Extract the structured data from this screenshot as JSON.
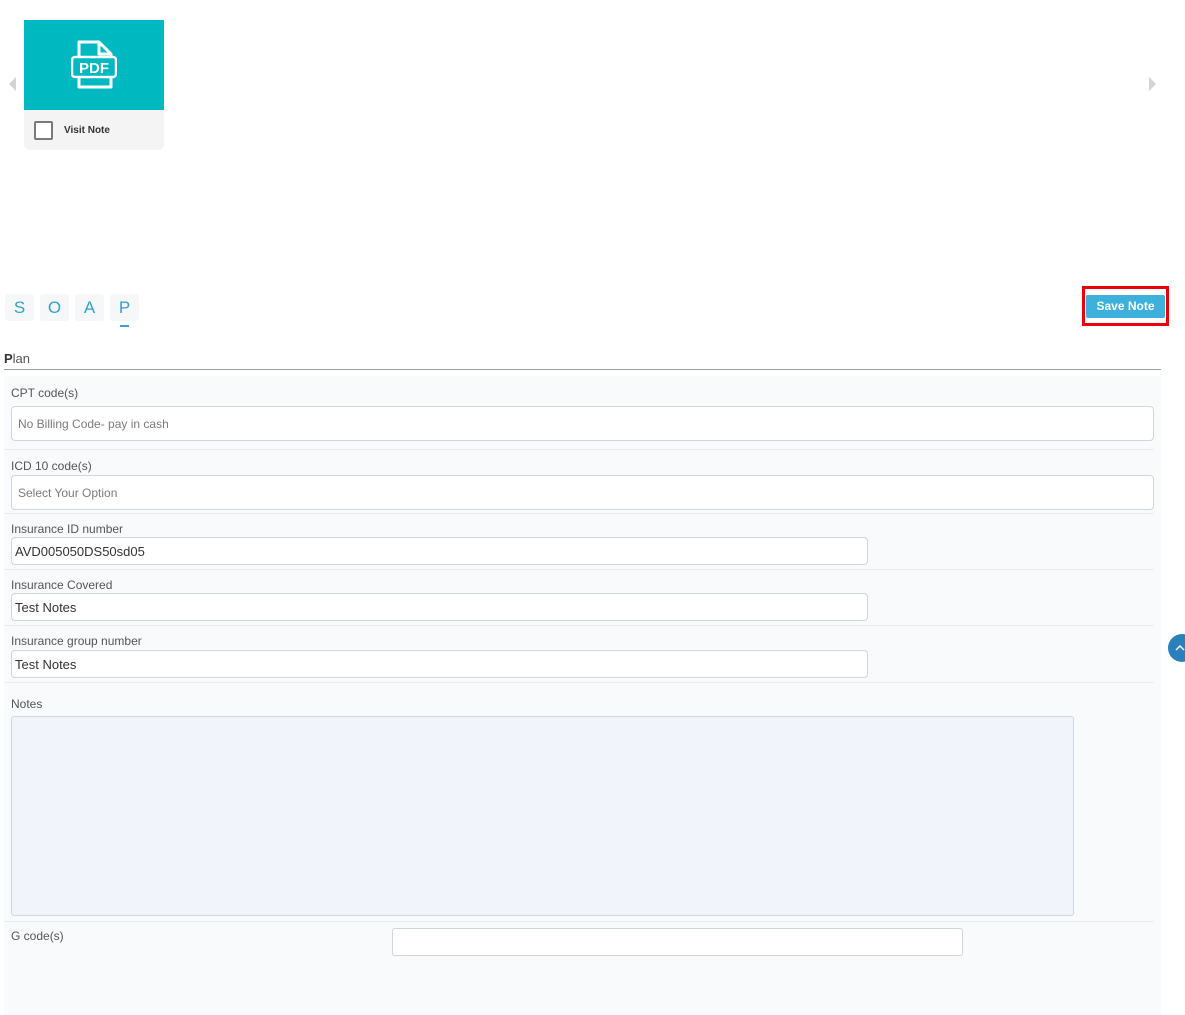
{
  "carousel": {
    "file": {
      "thumb_text": "PDF",
      "name": "Visit Note",
      "icon": "pdf-file-icon",
      "thumb_color": "#00b8bf"
    },
    "left_icon": "chevron-left-icon",
    "right_icon": "chevron-right-icon"
  },
  "tabs": [
    {
      "label": "S"
    },
    {
      "label": "O"
    },
    {
      "label": "A"
    },
    {
      "label": "P",
      "active": true
    }
  ],
  "save_button": {
    "label": "Save Note",
    "color": "#3db1dc",
    "highlight": "#e8000b"
  },
  "section": {
    "first_letter": "P",
    "rest": "lan"
  },
  "form": {
    "cpt": {
      "label": "CPT code(s)",
      "value": "No Billing Code- pay in cash"
    },
    "icd": {
      "label": "ICD 10 code(s)",
      "placeholder": "Select Your Option"
    },
    "insurance_id": {
      "label": "Insurance ID number",
      "value": "AVD005050DS50sd05"
    },
    "insurance_covered": {
      "label": "Insurance Covered",
      "value": "Test Notes"
    },
    "insurance_group": {
      "label": "Insurance group number",
      "value": "Test Notes"
    },
    "notes": {
      "label": "Notes",
      "value": ""
    },
    "g_codes": {
      "label": "G code(s)",
      "value": ""
    }
  },
  "scroll_top": {
    "icon": "chevron-up-icon"
  }
}
